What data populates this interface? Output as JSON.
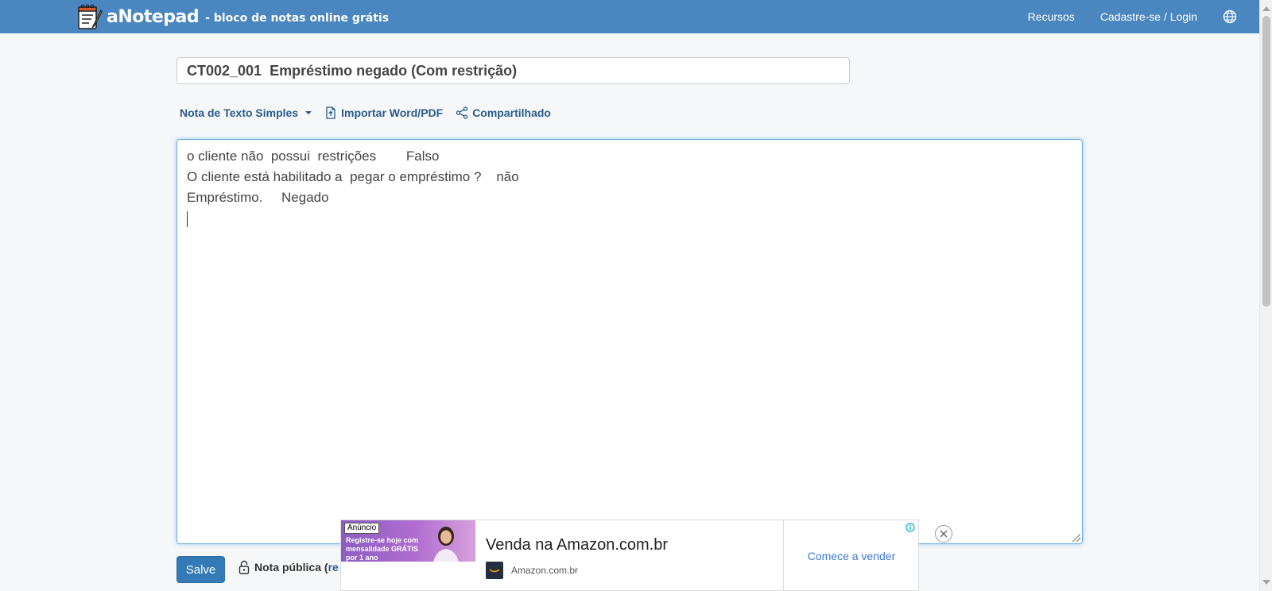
{
  "brand": {
    "name": "aNotepad",
    "tagline": "- bloco de notas online grátis",
    "color": "#4a86c0"
  },
  "nav": {
    "resources": "Recursos",
    "signup_login": "Cadastre-se / Login",
    "language_icon": "globe-icon"
  },
  "note": {
    "title": "CT002_001  Empréstimo negado (Com restrição)",
    "lines": [
      "o cliente não  possui  restrições        Falso",
      "O cliente está habilitado a  pegar o empréstimo ?    não",
      "Empréstimo.     Negado"
    ]
  },
  "toolbar": {
    "note_type": "Nota de Texto Simples",
    "import": "Importar Word/PDF",
    "share": "Compartilhado"
  },
  "footer": {
    "save_label": "Salve",
    "public_note_label": "Nota pública (",
    "public_note_link": "re"
  },
  "ad": {
    "label": "Anúncio",
    "image_text": "Registre-se hoje com mensalidade GRÁTIS por 1 ano",
    "title": "Venda na Amazon.com.br",
    "source": "Amazon.com.br",
    "cta": "Comece a vender"
  }
}
